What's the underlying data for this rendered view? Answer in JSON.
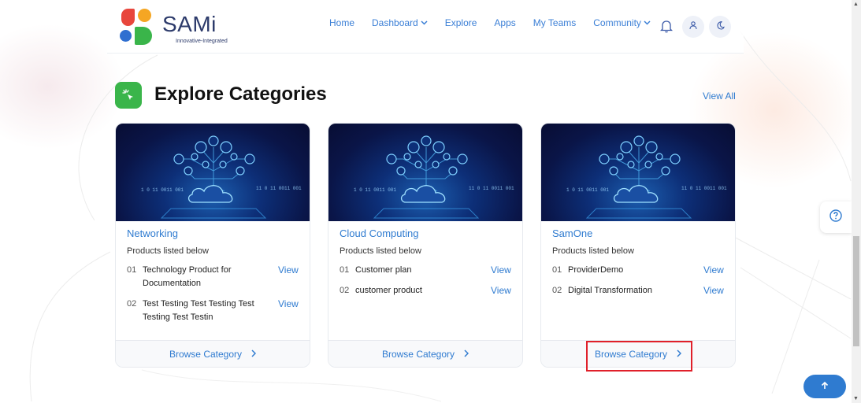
{
  "brand": {
    "name": "SAMi",
    "tagline": "Innovative-Integrated"
  },
  "nav": {
    "items": [
      {
        "label": "Home",
        "dropdown": false
      },
      {
        "label": "Dashboard",
        "dropdown": true
      },
      {
        "label": "Explore",
        "dropdown": false
      },
      {
        "label": "Apps",
        "dropdown": false
      },
      {
        "label": "My Teams",
        "dropdown": false
      },
      {
        "label": "Community",
        "dropdown": true
      }
    ],
    "icons": [
      "bell-icon",
      "user-icon",
      "moon-icon"
    ]
  },
  "section": {
    "title": "Explore Categories",
    "view_all": "View All",
    "icon": "pointer-click-icon"
  },
  "cards": [
    {
      "title": "Networking",
      "subtitle": "Products listed below",
      "products": [
        {
          "num": "01",
          "name": "Technology Product for Documentation",
          "action": "View"
        },
        {
          "num": "02",
          "name": "Test Testing Test Testing Test Testing Test Testin",
          "action": "View"
        }
      ],
      "browse": "Browse Category"
    },
    {
      "title": "Cloud Computing",
      "subtitle": "Products listed below",
      "products": [
        {
          "num": "01",
          "name": "Customer plan",
          "action": "View"
        },
        {
          "num": "02",
          "name": "customer product",
          "action": "View"
        }
      ],
      "browse": "Browse Category"
    },
    {
      "title": "SamOne",
      "subtitle": "Products listed below",
      "products": [
        {
          "num": "01",
          "name": "ProviderDemo",
          "action": "View"
        },
        {
          "num": "02",
          "name": "Digital Transformation",
          "action": "View"
        }
      ],
      "browse": "Browse Category"
    }
  ],
  "image_text": {
    "left": "1 0 11 0011 001",
    "right": "11 0 11 0011 001"
  },
  "colors": {
    "accent": "#2f7bd0",
    "section_icon": "#3ab54a",
    "highlight": "#e0202a",
    "brand_text": "#2d3b6b"
  },
  "widgets": {
    "help": "help-icon",
    "back_to_top": "arrow-up-icon"
  }
}
